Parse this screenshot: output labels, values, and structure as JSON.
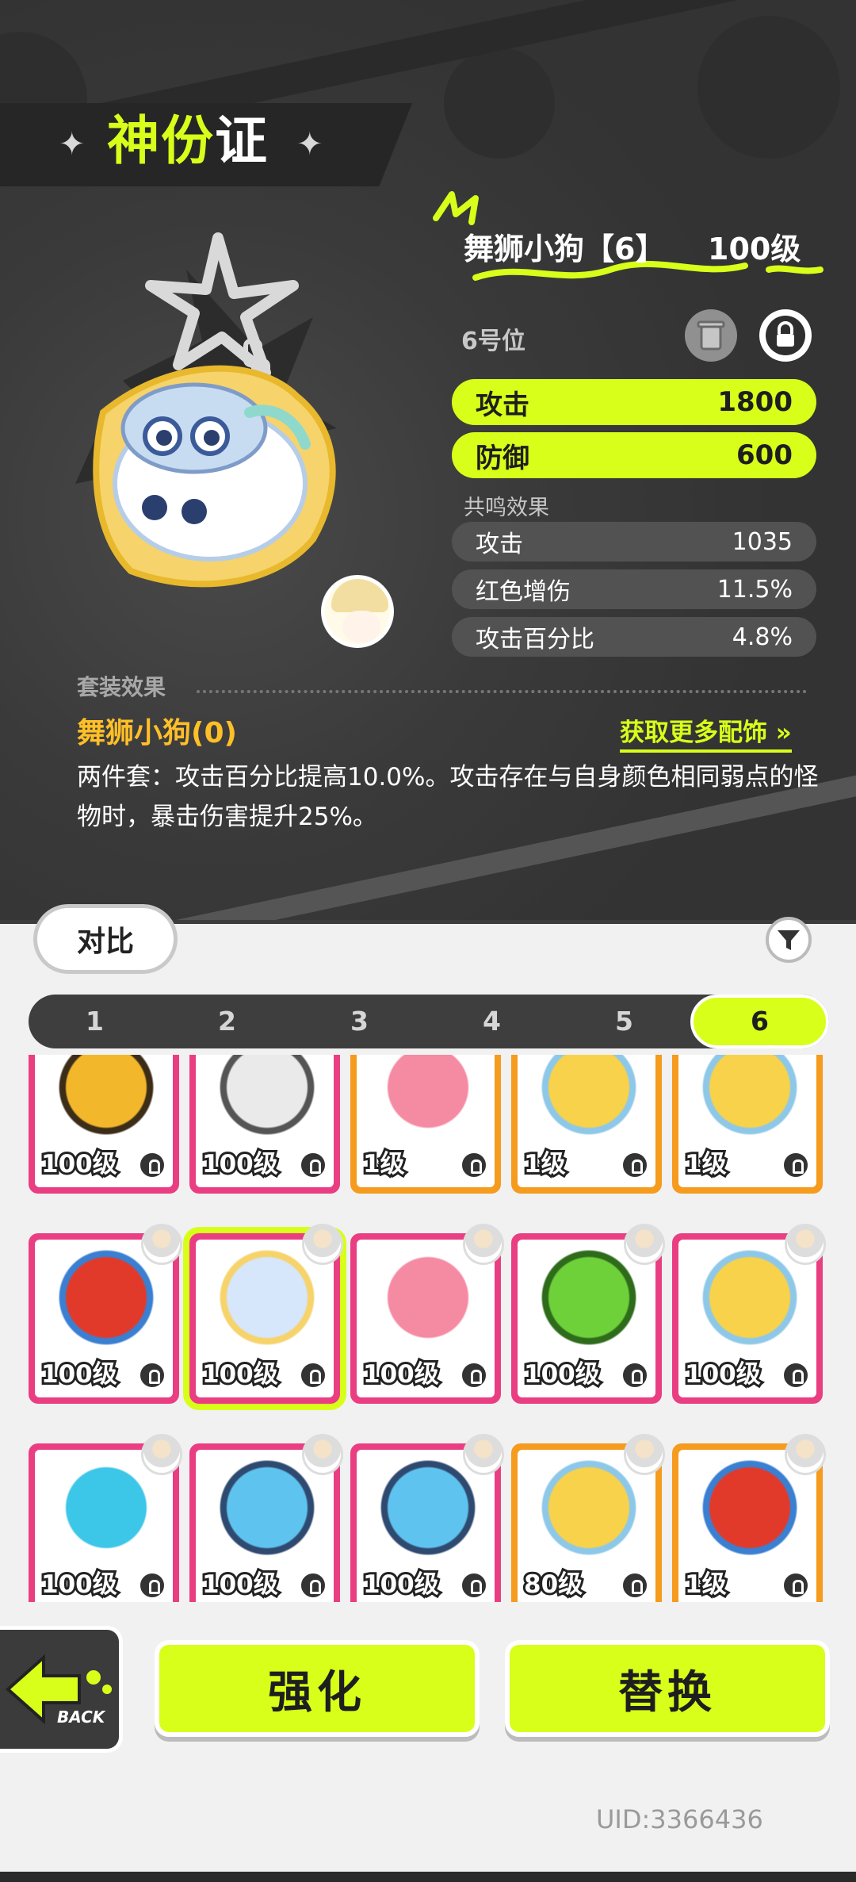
{
  "header": {
    "title_part1": "神份",
    "title_part2": "证"
  },
  "charm": {
    "name": "舞狮小狗【6】",
    "level": "100级",
    "slot": "6号位"
  },
  "main_stats": [
    {
      "label": "攻击",
      "value": "1800"
    },
    {
      "label": "防御",
      "value": "600"
    }
  ],
  "resonance": {
    "title": "共鸣效果",
    "stats": [
      {
        "label": "攻击",
        "value": "1035"
      },
      {
        "label": "红色增伤",
        "value": "11.5%"
      },
      {
        "label": "攻击百分比",
        "value": "4.8%"
      }
    ]
  },
  "set_effect": {
    "header": "套装效果",
    "name": "舞狮小狗(0)",
    "more_link": "获取更多配饰",
    "more_arrow": "»",
    "description": "两件套：攻击百分比提高10.0%。攻击存在与自身颜色相同弱点的怪物时，暴击伤害提升25%。"
  },
  "controls": {
    "compare": "对比",
    "filter_icon": "filter-icon"
  },
  "tabs": [
    "1",
    "2",
    "3",
    "4",
    "5",
    "6"
  ],
  "active_tab": "6",
  "inventory": [
    {
      "level": "100级",
      "frame": "pink",
      "art": "paw",
      "avatar": false
    },
    {
      "level": "100级",
      "frame": "pink",
      "art": "fired-note",
      "avatar": false
    },
    {
      "level": "1级",
      "frame": "orange",
      "art": "peach",
      "avatar": false
    },
    {
      "level": "1级",
      "frame": "orange",
      "art": "chick",
      "avatar": false
    },
    {
      "level": "1级",
      "frame": "orange",
      "art": "chick",
      "avatar": false
    },
    {
      "level": "100级",
      "frame": "pink",
      "art": "duck",
      "avatar": true
    },
    {
      "level": "100级",
      "frame": "pink",
      "art": "lion-dog",
      "avatar": true,
      "selected": true
    },
    {
      "level": "100级",
      "frame": "pink",
      "art": "peach",
      "avatar": true
    },
    {
      "level": "100级",
      "frame": "pink",
      "art": "frog",
      "avatar": true
    },
    {
      "level": "100级",
      "frame": "pink",
      "art": "chick",
      "avatar": true
    },
    {
      "level": "100级",
      "frame": "pink",
      "art": "mountain",
      "avatar": true
    },
    {
      "level": "100级",
      "frame": "pink",
      "art": "soda-cat",
      "avatar": true
    },
    {
      "level": "100级",
      "frame": "pink",
      "art": "soda-cat",
      "avatar": true
    },
    {
      "level": "80级",
      "frame": "orange",
      "art": "chick",
      "avatar": true
    },
    {
      "level": "1级",
      "frame": "orange",
      "art": "duck",
      "avatar": true
    }
  ],
  "actions": {
    "back": "BACK",
    "enhance": "强化",
    "replace": "替换"
  },
  "uid": "UID:3366436",
  "colors": {
    "accent": "#d7ff1a",
    "pink_frame": "#ea3e82",
    "orange_frame": "#f59b1e",
    "set_name": "#ffbf27"
  }
}
